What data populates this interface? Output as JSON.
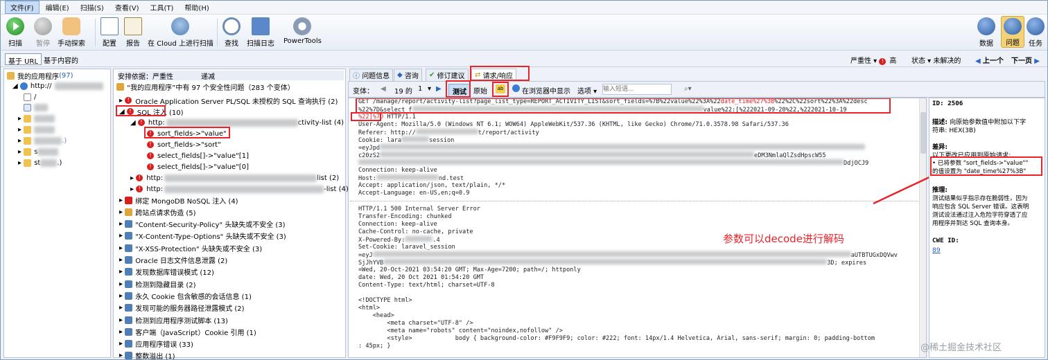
{
  "menubar": [
    "文件(F)",
    "编辑(E)",
    "扫描(S)",
    "查看(V)",
    "工具(T)",
    "帮助(H)"
  ],
  "toolbar": {
    "left": [
      "扫描",
      "暂停",
      "手动探索",
      "配置",
      "报告",
      "在 Cloud 上进行扫描",
      "查找",
      "扫描日志",
      "PowerTools"
    ],
    "right": [
      "数据",
      "问题",
      "任务"
    ]
  },
  "filter": {
    "by_url": "基于 URL",
    "by_content": "基于内容的",
    "severity": "严重性",
    "high": "高",
    "status": "状态",
    "unresolved": "未解决的",
    "prev": "上一个",
    "next": "下一页"
  },
  "left_tree": {
    "root": "我的应用程序",
    "root_count": "(97)",
    "child": "http://",
    "slash": "/",
    "folders": [
      "s",
      ".)",
      "st",
      ".)"
    ]
  },
  "middle": {
    "sort_label": "安排依据：严重性",
    "sort_value": "递减",
    "header": "“我的应用程序”中有 97 个安全性问题（283 个变体）",
    "items": [
      "Oracle Application Server PL/SQL 未授权的 SQL 查询执行 (2)",
      "SQL 注入 (10)",
      "http:",
      "ctivity-list (4)",
      "sort_fields->\"value\"",
      "sort_fields->\"sort\"",
      "select_fields[]->\"value\"[1]",
      "select_fields[]->\"value\"[0]",
      "list (2)",
      "-list (4)",
      "绑定 MongoDB NoSQL 注入 (4)",
      "跨站点请求伪造 (5)",
      "\"Content-Security-Policy\" 头缺失或不安全 (3)",
      "\"X-Content-Type-Options\" 头缺失或不安全 (3)",
      "\"X-XSS-Protection\" 头缺失或不安全 (3)",
      "Oracle 日志文件信息泄露 (2)",
      "发现数据库错误模式 (12)",
      "检测到隐藏目录 (2)",
      "永久 Cookie 包含敏感的会话信息 (1)",
      "发现可能的服务器路径泄露模式 (2)",
      "检测到应用程序测试脚本 (13)",
      "客户端（JavaScript）Cookie 引用 (1)",
      "应用程序错误 (33)",
      "整数溢出 (1)"
    ]
  },
  "tabs": [
    "问题信息",
    "咨询",
    "修订建议",
    "请求/响应"
  ],
  "req_toolbar": {
    "variant": "变体：",
    "index": "19 的",
    "num": "1",
    "test": "测试",
    "orig": "原始",
    "browser": "在浏览器中显示",
    "options": "选项",
    "search_ph": "输入短语..."
  },
  "request_lines": [
    "GET /manage/report/activity-list?page_list_type=REPORT_ACTIVITY_LIST&sort_fields=%7B%22value%22%3A%22",
    "date_time%27%3B",
    "%22%2C%22sort%22%3A%22desc",
    "%22%7D&select_f",
    "value%22:[%222021-09-20%22,%222021-10-19",
    "%22]%7D",
    " HTTP/1.1",
    "User-Agent: Mozilla/5.0 (Windows NT 6.1; WOW64) AppleWebKit/537.36 (KHTML, like Gecko) Chrome/71.0.3578.98 Safari/537.36",
    "Referer: http://",
    "t/report/activity",
    "Cookie: lara",
    "session",
    "=eyJpd",
    "c20zS2",
    "eDM3NmlaQlZsdHpscW55",
    "DdjOCJ9",
    "Connection: keep-alive",
    "Host:",
    "nd.test",
    "Accept: application/json, text/plain, */*",
    "Accept-Language: en-US,en;q=0.9"
  ],
  "response_lines": [
    "HTTP/1.1 500 Internal Server Error",
    "Transfer-Encoding: chunked",
    "Connection: keep-alive",
    "Cache-Control: no-cache, private",
    "X-Powered-By:",
    ".4",
    "Set-Cookie: laravel_session",
    "=eyJ",
    "aUTBTUGxDQVwv",
    "SjJhYVB",
    "3D; expires",
    "=Wed, 20-Oct-2021 03:54:20 GMT; Max-Age=7200; path=/; httponly",
    "date: Wed, 20 Oct 2021 01:54:20 GMT",
    "Content-Type: text/html; charset=UTF-8",
    "",
    "<!DOCTYPE html>",
    "<html>",
    "    <head>",
    "        <meta charset=\"UTF-8\" />",
    "        <meta name=\"robots\" content=\"noindex,nofollow\" />",
    "        <style>            body { background-color: #F9F9F9; color: #222; font: 14px/1.4 Helvetica, Arial, sans-serif; margin: 0; padding-bottom",
    ": 45px; }"
  ],
  "annotation": "参数可以decode进行解码",
  "right_panel": {
    "id": "ID: 2506",
    "desc_title": "描述:",
    "desc": [
      "向原始参数值中附加以下字",
      "符串: HEX(3B)"
    ],
    "diff_title": "差异:",
    "diff_sub": "以下更改已应用到原始请求:",
    "diff": [
      "• 已将参数 \"sort_fields->\"value\"\"",
      "的值设置为 \"date_time%27%3B\""
    ],
    "reason_title": "推理:",
    "reason": [
      "测试结果似乎指示存在脆弱性，因为",
      "响应包含 SQL Server 错误。这表明",
      "测试设法通过注入危险字符穿透了应",
      "用程序并到达 SQL 查询本身。"
    ],
    "cwe_title": "CWE ID:",
    "cwe": "89"
  },
  "watermark": "@稀土掘金技术社区",
  "colors": {
    "accent_red": "#e8232a",
    "link": "#1f5fbf"
  }
}
